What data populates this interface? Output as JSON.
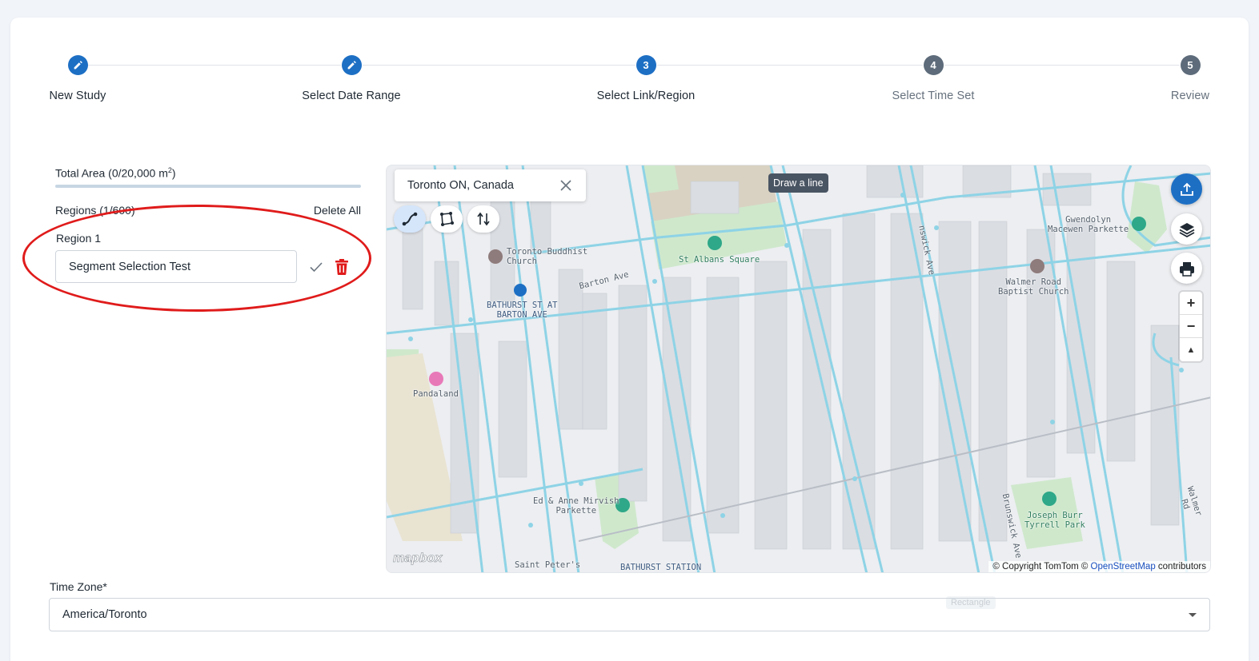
{
  "stepper": {
    "steps": [
      {
        "number": "1",
        "label": "New Study",
        "state": "done",
        "icon": "pencil-icon"
      },
      {
        "number": "2",
        "label": "Select Date Range",
        "state": "done",
        "icon": "pencil-icon"
      },
      {
        "number": "3",
        "label": "Select Link/Region",
        "state": "active"
      },
      {
        "number": "4",
        "label": "Select Time Set",
        "state": "pending"
      },
      {
        "number": "5",
        "label": "Review",
        "state": "pending"
      }
    ]
  },
  "regions_panel": {
    "total_area_prefix": "Total Area (0/20,000 m",
    "total_area_sup": "2",
    "total_area_suffix": ")",
    "total_area_progress": 0,
    "regions_count_label": "Regions (1/600)",
    "delete_all_label": "Delete All",
    "region_title": "Region 1",
    "region_name_value": "Segment Selection Test",
    "confirm_icon": "check-icon",
    "delete_icon": "trash-icon"
  },
  "map": {
    "search_value": "Toronto ON, Canada",
    "tooltip": "Draw a line",
    "tools": [
      "draw-line-icon",
      "draw-polygon-icon",
      "swap-direction-icon"
    ],
    "controls": [
      "upload-icon",
      "layers-icon",
      "print-icon"
    ],
    "zoom_in": "+",
    "zoom_out": "−",
    "compass": "▲",
    "logo": "mapbox",
    "attribution_prefix": "© Copyright TomTom © ",
    "attribution_link": "OpenStreetMap",
    "attribution_suffix": " contributors",
    "labels": {
      "buddhist": "Toronto Buddhist\nChurch",
      "stalbans": "St Albans Square",
      "barton": "Barton Ave",
      "bathurst_stop": "BATHURST ST AT\nBARTON AVE",
      "pandaland": "Pandaland",
      "mirvish": "Ed & Anne Mirvish\nParkette",
      "saintpeters": "Saint Peter's",
      "bathurst_station": "BATHURST STATION",
      "gwendolyn": "Gwendolyn\nMacewen Parkette",
      "walmer": "Walmer Road\nBaptist Church",
      "josephburr": "Joseph Burr\nTyrrell Park",
      "brunswick": "Brunswick Ave",
      "brunswick2": "nswick Ave",
      "walmer_rd": "Walmer Rd"
    },
    "colors": {
      "road": "#8ed3e6",
      "building": "#dde0e4",
      "park": "#cfe8cc",
      "water": "#e9e3d2"
    }
  },
  "timezone": {
    "label": "Time Zone*",
    "value": "America/Toronto",
    "ghost_label": "Rectangle"
  },
  "accent_color": "#1d6fc4",
  "annotation_color": "#e01b1b"
}
